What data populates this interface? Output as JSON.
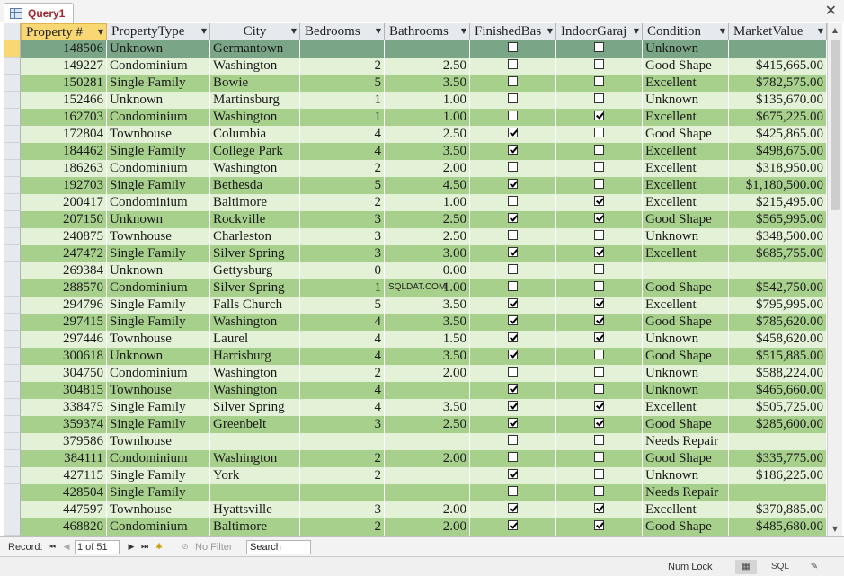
{
  "tab": {
    "title": "Query1"
  },
  "columns": [
    {
      "key": "property_no",
      "label": "Property #"
    },
    {
      "key": "type",
      "label": "PropertyType"
    },
    {
      "key": "city",
      "label": "City"
    },
    {
      "key": "bedrooms",
      "label": "Bedrooms"
    },
    {
      "key": "bathrooms",
      "label": "Bathrooms"
    },
    {
      "key": "finished_basement",
      "label": "FinishedBas"
    },
    {
      "key": "indoor_garage",
      "label": "IndoorGaraj"
    },
    {
      "key": "condition",
      "label": "Condition"
    },
    {
      "key": "market_value",
      "label": "MarketValue"
    }
  ],
  "rows": [
    {
      "id": "148506",
      "type": "Unknown",
      "city": "Germantown",
      "bed": "",
      "bath": "",
      "fb": false,
      "ig": false,
      "cond": "Unknown",
      "mv": ""
    },
    {
      "id": "149227",
      "type": "Condominium",
      "city": "Washington",
      "bed": "2",
      "bath": "2.50",
      "fb": false,
      "ig": false,
      "cond": "Good Shape",
      "mv": "$415,665.00"
    },
    {
      "id": "150281",
      "type": "Single Family",
      "city": "Bowie",
      "bed": "5",
      "bath": "3.50",
      "fb": false,
      "ig": false,
      "cond": "Excellent",
      "mv": "$782,575.00"
    },
    {
      "id": "152466",
      "type": "Unknown",
      "city": "Martinsburg",
      "bed": "1",
      "bath": "1.00",
      "fb": false,
      "ig": false,
      "cond": "Unknown",
      "mv": "$135,670.00"
    },
    {
      "id": "162703",
      "type": "Condominium",
      "city": "Washington",
      "bed": "1",
      "bath": "1.00",
      "fb": false,
      "ig": true,
      "cond": "Excellent",
      "mv": "$675,225.00"
    },
    {
      "id": "172804",
      "type": "Townhouse",
      "city": "Columbia",
      "bed": "4",
      "bath": "2.50",
      "fb": true,
      "ig": false,
      "cond": "Good Shape",
      "mv": "$425,865.00"
    },
    {
      "id": "184462",
      "type": "Single Family",
      "city": "College Park",
      "bed": "4",
      "bath": "3.50",
      "fb": true,
      "ig": false,
      "cond": "Excellent",
      "mv": "$498,675.00"
    },
    {
      "id": "186263",
      "type": "Condominium",
      "city": "Washington",
      "bed": "2",
      "bath": "2.00",
      "fb": false,
      "ig": false,
      "cond": "Excellent",
      "mv": "$318,950.00"
    },
    {
      "id": "192703",
      "type": "Single Family",
      "city": "Bethesda",
      "bed": "5",
      "bath": "4.50",
      "fb": true,
      "ig": false,
      "cond": "Excellent",
      "mv": "$1,180,500.00"
    },
    {
      "id": "200417",
      "type": "Condominium",
      "city": "Baltimore",
      "bed": "2",
      "bath": "1.00",
      "fb": false,
      "ig": true,
      "cond": "Excellent",
      "mv": "$215,495.00"
    },
    {
      "id": "207150",
      "type": "Unknown",
      "city": "Rockville",
      "bed": "3",
      "bath": "2.50",
      "fb": true,
      "ig": true,
      "cond": "Good Shape",
      "mv": "$565,995.00"
    },
    {
      "id": "240875",
      "type": "Townhouse",
      "city": "Charleston",
      "bed": "3",
      "bath": "2.50",
      "fb": false,
      "ig": false,
      "cond": "Unknown",
      "mv": "$348,500.00"
    },
    {
      "id": "247472",
      "type": "Single Family",
      "city": "Silver Spring",
      "bed": "3",
      "bath": "3.00",
      "fb": true,
      "ig": true,
      "cond": "Excellent",
      "mv": "$685,755.00"
    },
    {
      "id": "269384",
      "type": "Unknown",
      "city": "Gettysburg",
      "bed": "0",
      "bath": "0.00",
      "fb": false,
      "ig": false,
      "cond": "",
      "mv": ""
    },
    {
      "id": "288570",
      "type": "Condominium",
      "city": "Silver Spring",
      "bed": "1",
      "bath": "1.00",
      "fb": false,
      "ig": false,
      "cond": "Good Shape",
      "mv": "$542,750.00"
    },
    {
      "id": "294796",
      "type": "Single Family",
      "city": "Falls Church",
      "bed": "5",
      "bath": "3.50",
      "fb": true,
      "ig": true,
      "cond": "Excellent",
      "mv": "$795,995.00"
    },
    {
      "id": "297415",
      "type": "Single Family",
      "city": "Washington",
      "bed": "4",
      "bath": "3.50",
      "fb": true,
      "ig": true,
      "cond": "Good Shape",
      "mv": "$785,620.00"
    },
    {
      "id": "297446",
      "type": "Townhouse",
      "city": "Laurel",
      "bed": "4",
      "bath": "1.50",
      "fb": true,
      "ig": true,
      "cond": "Unknown",
      "mv": "$458,620.00"
    },
    {
      "id": "300618",
      "type": "Unknown",
      "city": "Harrisburg",
      "bed": "4",
      "bath": "3.50",
      "fb": true,
      "ig": false,
      "cond": "Good Shape",
      "mv": "$515,885.00"
    },
    {
      "id": "304750",
      "type": "Condominium",
      "city": "Washington",
      "bed": "2",
      "bath": "2.00",
      "fb": false,
      "ig": false,
      "cond": "Unknown",
      "mv": "$588,224.00"
    },
    {
      "id": "304815",
      "type": "Townhouse",
      "city": "Washington",
      "bed": "4",
      "bath": "",
      "fb": true,
      "ig": false,
      "cond": "Unknown",
      "mv": "$465,660.00"
    },
    {
      "id": "338475",
      "type": "Single Family",
      "city": "Silver Spring",
      "bed": "4",
      "bath": "3.50",
      "fb": true,
      "ig": true,
      "cond": "Excellent",
      "mv": "$505,725.00"
    },
    {
      "id": "359374",
      "type": "Single Family",
      "city": "Greenbelt",
      "bed": "3",
      "bath": "2.50",
      "fb": true,
      "ig": true,
      "cond": "Good Shape",
      "mv": "$285,600.00"
    },
    {
      "id": "379586",
      "type": "Townhouse",
      "city": "",
      "bed": "",
      "bath": "",
      "fb": false,
      "ig": false,
      "cond": "Needs Repair",
      "mv": ""
    },
    {
      "id": "384111",
      "type": "Condominium",
      "city": "Washington",
      "bed": "2",
      "bath": "2.00",
      "fb": false,
      "ig": false,
      "cond": "Good Shape",
      "mv": "$335,775.00"
    },
    {
      "id": "427115",
      "type": "Single Family",
      "city": "York",
      "bed": "2",
      "bath": "",
      "fb": true,
      "ig": false,
      "cond": "Unknown",
      "mv": "$186,225.00"
    },
    {
      "id": "428504",
      "type": "Single Family",
      "city": "",
      "bed": "",
      "bath": "",
      "fb": false,
      "ig": false,
      "cond": "Needs Repair",
      "mv": ""
    },
    {
      "id": "447597",
      "type": "Townhouse",
      "city": "Hyattsville",
      "bed": "3",
      "bath": "2.00",
      "fb": true,
      "ig": true,
      "cond": "Excellent",
      "mv": "$370,885.00"
    },
    {
      "id": "468820",
      "type": "Condominium",
      "city": "Baltimore",
      "bed": "2",
      "bath": "2.00",
      "fb": true,
      "ig": true,
      "cond": "Good Shape",
      "mv": "$485,680.00"
    }
  ],
  "navigation": {
    "record_label": "Record:",
    "record_position": "1 of 51",
    "filter_label": "No Filter",
    "search_text": "Search"
  },
  "status": {
    "num_lock": "Num Lock",
    "sql_view": "SQL"
  },
  "watermark": "SQLDAT.COM",
  "colors": {
    "row_light": "#e3f1d6",
    "row_dark": "#a8d08d",
    "row_current": "#7aa687",
    "header_active": "#f9d873",
    "tab_title": "#a4262c"
  }
}
